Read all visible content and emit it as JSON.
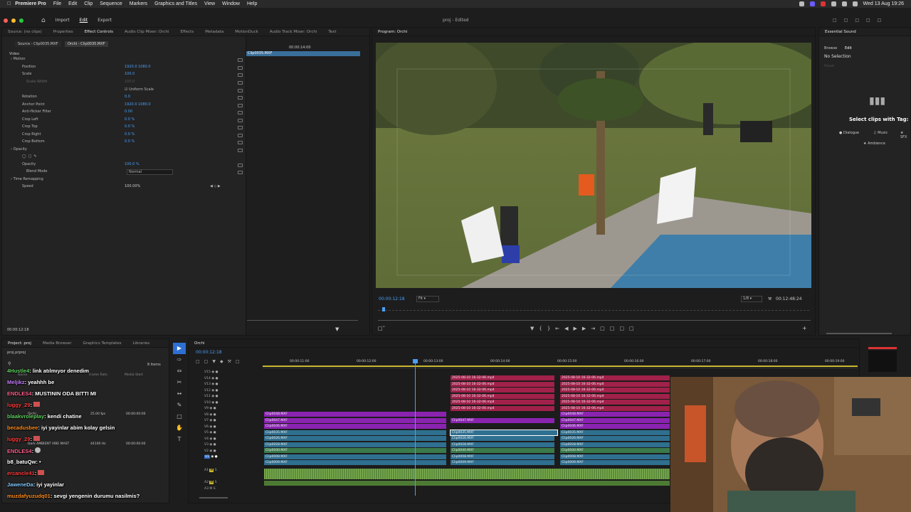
{
  "menubar": {
    "app": "Premiere Pro",
    "items": [
      "File",
      "Edit",
      "Clip",
      "Sequence",
      "Markers",
      "Graphics and Titles",
      "View",
      "Window",
      "Help"
    ],
    "clock": "Wed 13 Aug 19:26"
  },
  "header": {
    "tabs": [
      "Import",
      "Edit",
      "Export"
    ],
    "title": "proj - Edited"
  },
  "left_panel": {
    "tabs": [
      "Source: (no clips)",
      "Properties",
      "Effect Controls",
      "Audio Clip Mixer: Orchi",
      "Effects",
      "Metadata",
      "MotionDuck",
      "Audio Track Mixer: Orchi",
      "Text"
    ],
    "source_tab": "Source - Clip0035.MXF",
    "sequence_tab": "Orchi - Clip0035.MXF",
    "mini_time": "00:00:14:00",
    "mini_clip": "Clip0035.MXF",
    "section_video": "Video",
    "rows": [
      {
        "label": "Motion",
        "value": ""
      },
      {
        "label": "Position",
        "value": "1920.0   1080.0"
      },
      {
        "label": "Scale",
        "value": "100.0"
      },
      {
        "label": "Scale Width",
        "value": "100.0"
      },
      {
        "label": "",
        "value": "Uniform Scale"
      },
      {
        "label": "Rotation",
        "value": "0.0"
      },
      {
        "label": "Anchor Point",
        "value": "1920.0   1080.0"
      },
      {
        "label": "Anti-flicker Filter",
        "value": "0.00"
      },
      {
        "label": "Crop Left",
        "value": "0.0 %"
      },
      {
        "label": "Crop Top",
        "value": "0.0 %"
      },
      {
        "label": "Crop Right",
        "value": "0.0 %"
      },
      {
        "label": "Crop Bottom",
        "value": "0.0 %"
      },
      {
        "label": "Opacity",
        "value": ""
      },
      {
        "label": "",
        "value": ""
      },
      {
        "label": "Opacity",
        "value": "100.0 %"
      },
      {
        "label": "Blend Mode",
        "value": "Normal"
      },
      {
        "label": "Time Remapping",
        "value": ""
      },
      {
        "label": "Speed",
        "value": "100.00%"
      }
    ],
    "timecode": "00:00:12:18"
  },
  "program": {
    "tab": "Program: Orchi",
    "timecode": "00:00:12:18",
    "fit": "Fit",
    "resolution": "1/8",
    "duration": "00:12:48:24"
  },
  "essential_sound": {
    "tab": "Essential Sound",
    "browse": "Browse",
    "edit": "Edit",
    "no_selection": "No Selection",
    "presets": "Preset",
    "select_clips": "Select clips with Tag:",
    "tags": [
      "Dialogue",
      "Music",
      "SFX",
      "Ambience"
    ]
  },
  "project": {
    "tabs": [
      "Project: proj",
      "Media Browser",
      "Graphics Templates",
      "Libraries"
    ],
    "name": "proj.prproj",
    "items": "8 items",
    "cols": [
      "Name",
      "Frame Rate",
      "Media Start"
    ],
    "row1": [
      "Orchi",
      "25.00 fps",
      "00:00:00:00"
    ],
    "row2": [
      "Dark AMBIENT VIBE MAST",
      "44100 Hz",
      "00:00:00:00"
    ]
  },
  "chat": [
    {
      "user": "4Hustle4",
      "msg": "link atılmıyor denedim",
      "color": "#5fd15f"
    },
    {
      "user": "Meljikz",
      "msg": "yeahhh be",
      "color": "#c77dff"
    },
    {
      "user": "ENDLES4",
      "msg": "MUSTININ ODA BITTI MI",
      "color": "#ff5c8a"
    },
    {
      "user": "luggy_29",
      "msg": "",
      "color": "#ff3b3b"
    },
    {
      "user": "blaakvroleplay",
      "msg": "kendi chatine",
      "color": "#5fd15f"
    },
    {
      "user": "becadusbee",
      "msg": "iyi yayinlar abim kolay gelsin",
      "color": "#ff8c1a"
    },
    {
      "user": "luggy_29",
      "msg": "",
      "color": "#ff3b3b"
    },
    {
      "user": "ENDLES4",
      "msg": "",
      "color": "#ff5c8a"
    },
    {
      "user": "b8_batuQw",
      "msg": "",
      "color": "#ffffff"
    },
    {
      "user": "ercancle41",
      "msg": "",
      "color": "#ff3b3b"
    },
    {
      "user": "JaweneDa",
      "msg": "iyi yayinlar",
      "color": "#7ec8ff"
    },
    {
      "user": "muzdafyuzudq01",
      "msg": "sevgi yengenin durumu nasilmis?",
      "color": "#ff8c1a"
    }
  ],
  "timeline": {
    "tab": "Orchi",
    "timecode": "00:00:12:18",
    "ruler": [
      "00:00:11:00",
      "00:00:12:00",
      "00:00:13:00",
      "00:00:14:00",
      "00:00:15:00",
      "00:00:16:00",
      "00:00:17:00",
      "00:00:18:00",
      "00:00:19:00"
    ],
    "tracks": [
      "V15",
      "V14",
      "V13",
      "V12",
      "V11",
      "V10",
      "V9",
      "V8",
      "V7",
      "V6",
      "V5",
      "V4",
      "V3",
      "V2",
      "V1",
      "A1",
      "A2",
      "A3"
    ],
    "clips": {
      "red": "2025-08-10 16-32-06.mp4",
      "v9": "Clip0048.MXF",
      "v8": "Clip0047.MXF",
      "v7": "Clip0046.MXF",
      "v6": "Clip0035.MXF",
      "v5": "Clip0026.MXF",
      "v4": "Clip0028.MXF",
      "v3": "Clip0040.MXF",
      "v2": "Clip0008.MXF",
      "v1": "Clip0009.MXF"
    }
  },
  "colors": {
    "accent": "#4a9ef5",
    "clip_red": "#a0214a",
    "clip_purple": "#8a23b0",
    "clip_teal": "#2f6f8f",
    "clip_green": "#3b7a4b",
    "audio_green": "#5c8c3c"
  }
}
